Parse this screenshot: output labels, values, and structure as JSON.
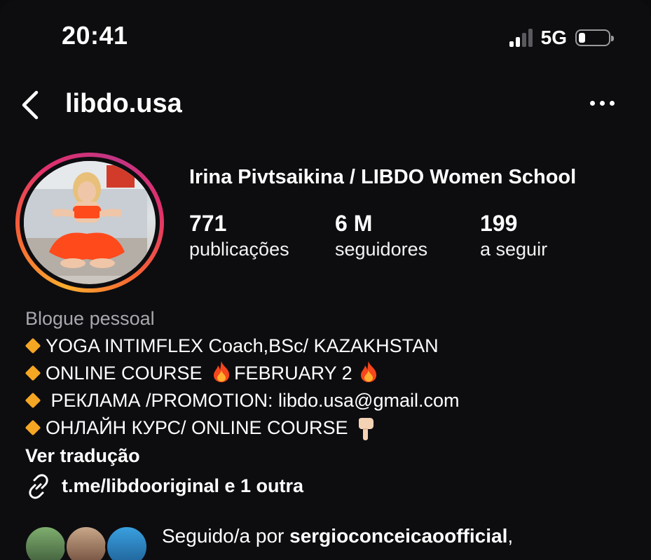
{
  "status": {
    "time": "20:41",
    "network": "5G"
  },
  "header": {
    "username": "libdo.usa"
  },
  "profile": {
    "full_name": "Irina Pivtsaikina / LIBDO Women School",
    "stats": [
      {
        "value": "771",
        "label": "publicações"
      },
      {
        "value": "6 M",
        "label": "seguidores"
      },
      {
        "value": "199",
        "label": "a seguir"
      }
    ]
  },
  "bio": {
    "category": "Blogue pessoal",
    "lines": [
      "YOGA INTIMFLEX Coach,BSc/ KAZAKHSTAN",
      "ONLINE COURSE",
      "FEBRUARY 2",
      " РЕКЛАМА /PROMOTION: libdo.usa@gmail.com",
      "ОНЛАЙН КУРС/ ONLINE COURSE"
    ],
    "translate": "Ver tradução",
    "link": "t.me/libdooriginal e 1 outra"
  },
  "followed_by": {
    "prefix": "Seguido/a por ",
    "name": "sergioconceicaoofficial",
    "suffix": ","
  },
  "colors": {
    "accent_diamond": "#f5a623",
    "background": "#0d0d10"
  },
  "icons": [
    "chevron-left-icon",
    "more-icon",
    "link-icon",
    "fire-icon",
    "pointing-down-icon",
    "diamond-icon"
  ]
}
